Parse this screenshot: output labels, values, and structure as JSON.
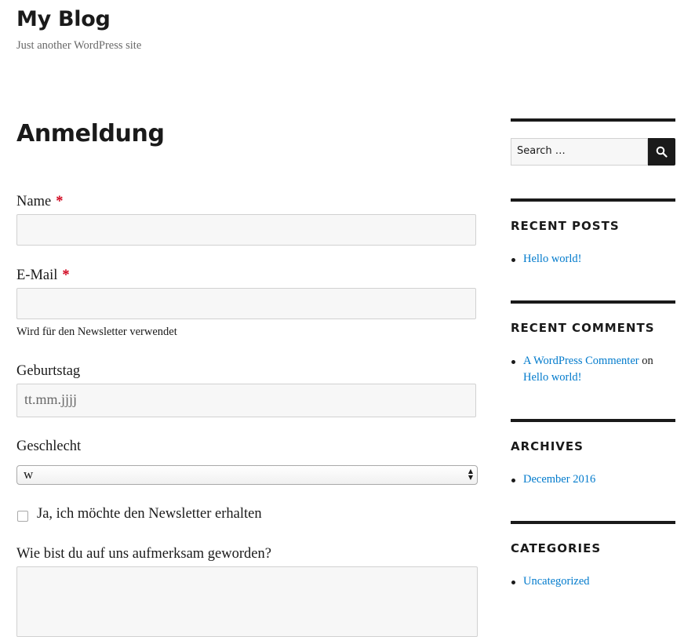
{
  "site": {
    "title": "My Blog",
    "description": "Just another WordPress site"
  },
  "page": {
    "title": "Anmeldung"
  },
  "form": {
    "name": {
      "label": "Name",
      "required_mark": "*",
      "value": ""
    },
    "email": {
      "label": "E-Mail",
      "required_mark": "*",
      "value": "",
      "hint": "Wird für den Newsletter verwendet"
    },
    "birthday": {
      "label": "Geburtstag",
      "placeholder": "tt.mm.jjjj"
    },
    "gender": {
      "label": "Geschlecht",
      "selected": "w"
    },
    "newsletter": {
      "label": "Ja, ich möchte den Newsletter erhalten",
      "checked": false
    },
    "source": {
      "label": "Wie bist du auf uns aufmerksam geworden?",
      "value": ""
    }
  },
  "sidebar": {
    "search": {
      "placeholder": "Search …"
    },
    "recent_posts": {
      "title": "RECENT POSTS",
      "items": [
        "Hello world!"
      ]
    },
    "recent_comments": {
      "title": "RECENT COMMENTS",
      "items": [
        {
          "author": "A WordPress Commenter",
          "connector": "on",
          "post": "Hello world!"
        }
      ]
    },
    "archives": {
      "title": "ARCHIVES",
      "items": [
        "December 2016"
      ]
    },
    "categories": {
      "title": "CATEGORIES",
      "items": [
        "Uncategorized"
      ]
    }
  },
  "colors": {
    "text": "#1a1a1a",
    "link": "#007acc",
    "required": "#d0021b",
    "input_bg": "#f7f7f7",
    "input_border": "#d1d1d1",
    "muted": "#686868"
  }
}
